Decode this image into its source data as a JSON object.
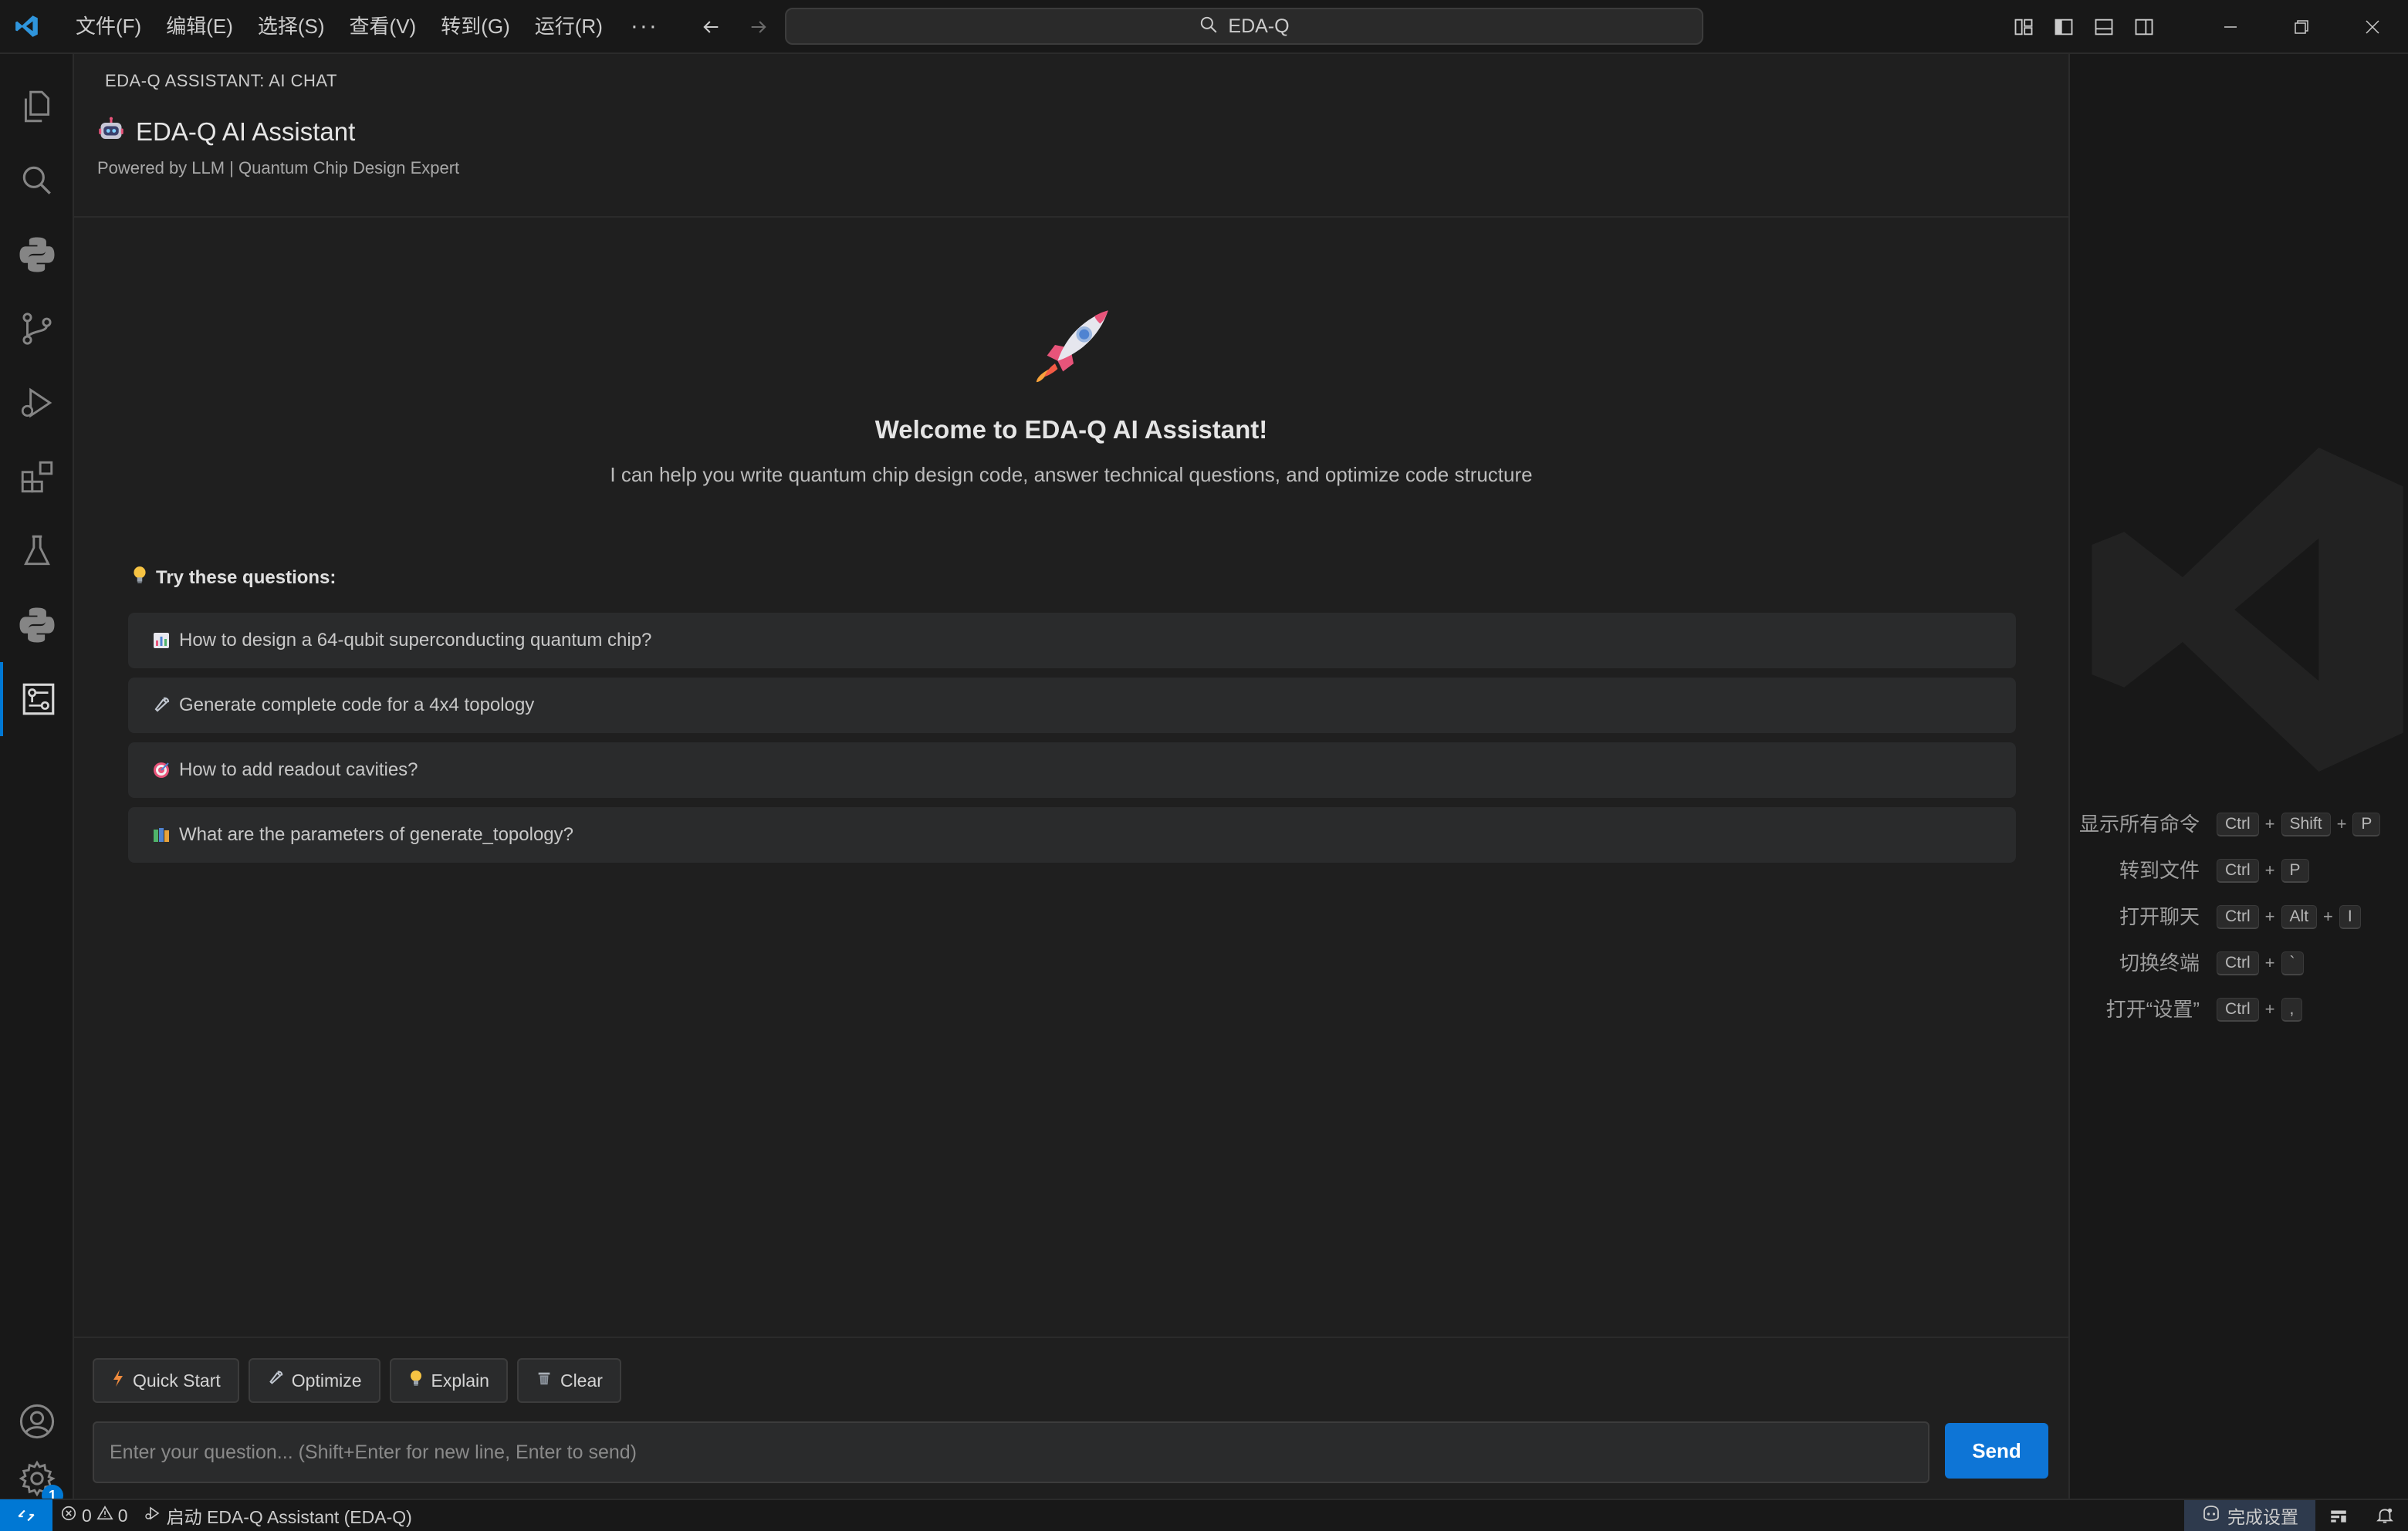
{
  "titlebar": {
    "menu": [
      "文件(F)",
      "编辑(E)",
      "选择(S)",
      "查看(V)",
      "转到(G)",
      "运行(R)"
    ],
    "more": "···",
    "search_text": "EDA-Q"
  },
  "activitybar": {
    "icons": [
      "explorer-icon",
      "search-icon",
      "python-icon",
      "source-control-icon",
      "run-debug-icon",
      "extensions-icon",
      "testing-icon",
      "python-env-icon",
      "eda-q-icon",
      "account-icon",
      "settings-icon"
    ],
    "settings_badge": "1"
  },
  "panel": {
    "header": "EDA-Q ASSISTANT: AI CHAT",
    "title": "EDA-Q AI Assistant",
    "subtitle": "Powered by LLM | Quantum Chip Design Expert"
  },
  "welcome": {
    "title": "Welcome to EDA-Q AI Assistant!",
    "description": "I can help you write quantum chip design code, answer technical questions, and optimize code structure",
    "try_label": "Try these questions:"
  },
  "suggestions": [
    {
      "icon": "chart-icon",
      "text": "How to design a 64-qubit superconducting quantum chip?"
    },
    {
      "icon": "wrench-icon",
      "text": "Generate complete code for a 4x4 topology"
    },
    {
      "icon": "target-icon",
      "text": "How to add readout cavities?"
    },
    {
      "icon": "books-icon",
      "text": "What are the parameters of generate_topology?"
    }
  ],
  "quick_actions": [
    {
      "icon": "lightning-icon",
      "label": "Quick Start"
    },
    {
      "icon": "wrench-icon",
      "label": "Optimize"
    },
    {
      "icon": "bulb-icon",
      "label": "Explain"
    },
    {
      "icon": "trash-icon",
      "label": "Clear"
    }
  ],
  "input": {
    "placeholder": "Enter your question... (Shift+Enter for new line, Enter to send)",
    "send_label": "Send"
  },
  "shortcuts": [
    {
      "label": "显示所有命令",
      "keys": [
        "Ctrl",
        "Shift",
        "P"
      ]
    },
    {
      "label": "转到文件",
      "keys": [
        "Ctrl",
        "P"
      ]
    },
    {
      "label": "打开聊天",
      "keys": [
        "Ctrl",
        "Alt",
        "I"
      ]
    },
    {
      "label": "切换终端",
      "keys": [
        "Ctrl",
        "`"
      ]
    },
    {
      "label": "打开“设置”",
      "keys": [
        "Ctrl",
        ","
      ]
    }
  ],
  "statusbar": {
    "errors": "0",
    "warnings": "0",
    "launch_text": "启动 EDA-Q Assistant (EDA-Q)",
    "setup_text": "完成设置"
  },
  "colors": {
    "accent": "#0078d4",
    "send_button": "#0e75d6",
    "background": "#1f1f1f",
    "chrome": "#181818"
  }
}
